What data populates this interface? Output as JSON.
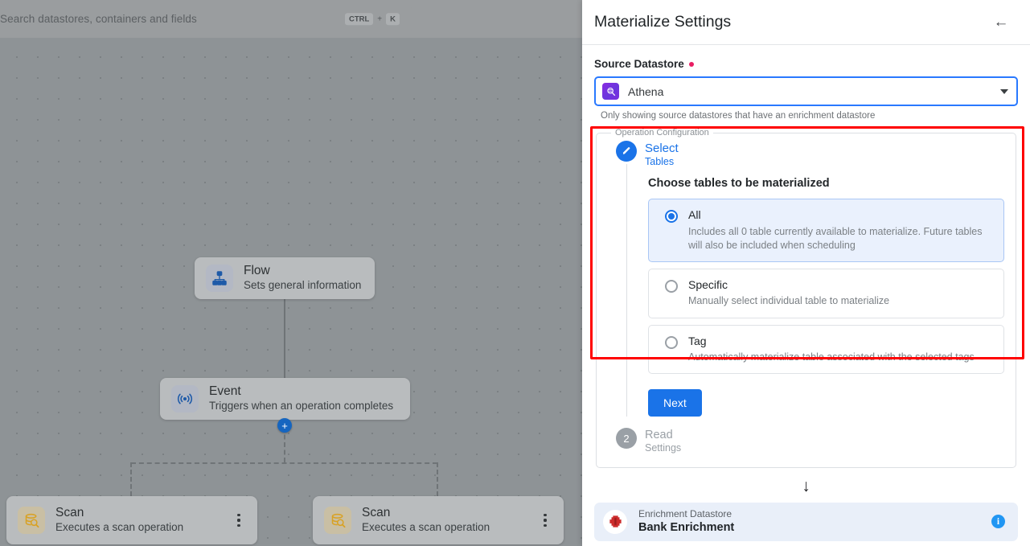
{
  "canvas": {
    "search": {
      "placeholder": "Search datastores, containers and fields",
      "kbd_ctrl": "CTRL",
      "kbd_plus": "+",
      "kbd_key": "K"
    },
    "nodes": [
      {
        "title": "Flow",
        "subtitle": "Sets general information"
      },
      {
        "title": "Event",
        "subtitle": "Triggers when an operation completes"
      },
      {
        "title": "Scan",
        "subtitle": "Executes a scan operation"
      },
      {
        "title": "Scan",
        "subtitle": "Executes a scan operation"
      }
    ],
    "add_node_label": "+"
  },
  "drawer": {
    "title": "Materialize Settings",
    "back_label": "←",
    "source_datastore": {
      "label": "Source Datastore",
      "value": "Athena",
      "helper": "Only showing source datastores that have an enrichment datastore"
    },
    "operation_configuration": {
      "legend": "Operation Configuration",
      "step1": {
        "badge": "✓",
        "title": "Select",
        "subtitle": "Tables",
        "heading": "Choose tables to be materialized",
        "options": [
          {
            "title": "All",
            "description": "Includes all 0 table currently available to materialize. Future tables will also be included when scheduling",
            "selected": true
          },
          {
            "title": "Specific",
            "description": "Manually select individual table to materialize",
            "selected": false
          },
          {
            "title": "Tag",
            "description": "Automatically materialize table associated with the selected tags",
            "selected": false
          }
        ],
        "next_label": "Next"
      },
      "step2": {
        "badge": "2",
        "title": "Read",
        "subtitle": "Settings"
      }
    },
    "flow_arrow": "↓",
    "enrichment": {
      "caption": "Enrichment Datastore",
      "name": "Bank Enrichment",
      "info_label": "i"
    }
  },
  "colors": {
    "accent_blue": "#1a73e8",
    "highlight_red": "#ff0000",
    "required_pink": "#e91e63",
    "athena_purple": "#7b2fe0",
    "enrichment_red": "#c62828"
  }
}
